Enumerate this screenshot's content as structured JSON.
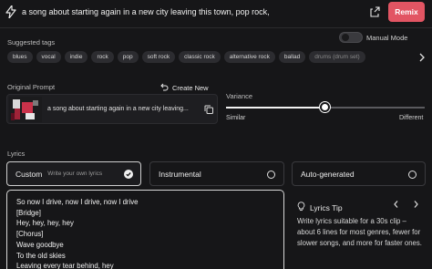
{
  "header": {
    "prompt": "a song about starting again in a new city leaving this town, pop rock,",
    "remix_label": "Remix"
  },
  "suggested_tags": {
    "label": "Suggested tags",
    "manual_mode_label": "Manual Mode",
    "manual_mode_on": false,
    "tags": [
      "blues",
      "vocal",
      "indie",
      "rock",
      "pop",
      "soft rock",
      "classic rock",
      "alternative rock",
      "ballad",
      "drums (drum set)"
    ]
  },
  "original_prompt": {
    "label": "Original Prompt",
    "create_new_label": "Create New",
    "text": "a song about starting again in a new city leaving..."
  },
  "variance": {
    "label": "Variance",
    "value": 0.5,
    "min_label": "Similar",
    "max_label": "Different"
  },
  "lyrics": {
    "label": "Lyrics",
    "options": [
      {
        "label": "Custom",
        "hint": "Write your own lyrics",
        "selected": true
      },
      {
        "label": "Instrumental",
        "hint": "",
        "selected": false
      },
      {
        "label": "Auto-generated",
        "hint": "",
        "selected": false
      }
    ],
    "lines": [
      "So now I drive, now I drive, now I drive",
      "[Bridge]",
      "Hey, hey, hey, hey",
      "[Chorus]",
      "Wave goodbye",
      "To the old skies",
      "Leaving every tear behind, hey"
    ]
  },
  "tip": {
    "title": "Lyrics Tip",
    "body": "Write lyrics suitable for a 30s clip – about 6 lines for most genres, fewer for slower songs, and more for faster ones."
  },
  "colors": {
    "background": "#161618",
    "accent": "#e25563"
  }
}
